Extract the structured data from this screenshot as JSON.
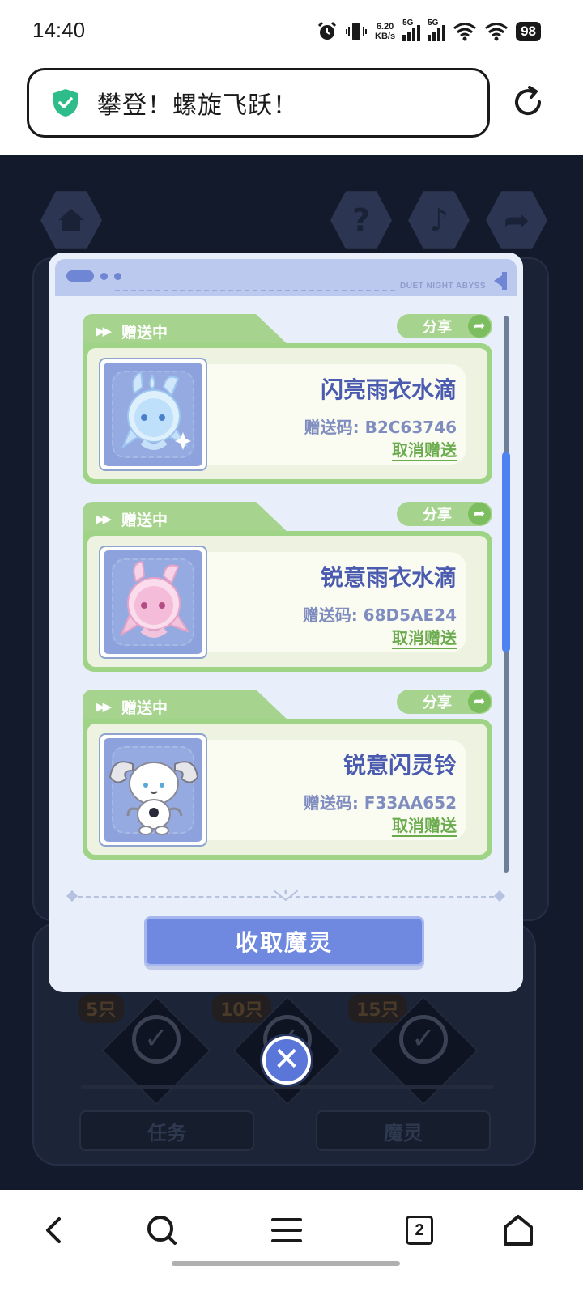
{
  "status_bar": {
    "time": "14:40",
    "net_speed_value": "6.20",
    "net_speed_unit": "KB/s",
    "sim1_label": "5G",
    "sim2_label": "5G",
    "battery": "98",
    "icons": [
      "alarm-icon",
      "vibrate-icon",
      "signal-icon",
      "wifi-icon",
      "battery-icon"
    ]
  },
  "browser": {
    "page_title": "攀登！螺旋飞跃！",
    "secure_icon": "shield-check-icon",
    "reload_icon": "reload-icon"
  },
  "modal": {
    "header_brand": "DUET NIGHT ABYSS",
    "cards": [
      {
        "status": "赠送中",
        "share_label": "分享",
        "name": "闪亮雨衣水滴",
        "code_label": "赠送码:",
        "code": "B2C63746",
        "cancel_label": "取消赠送"
      },
      {
        "status": "赠送中",
        "share_label": "分享",
        "name": "锐意雨衣水滴",
        "code_label": "赠送码:",
        "code": "68D5AE24",
        "cancel_label": "取消赠送"
      },
      {
        "status": "赠送中",
        "share_label": "分享",
        "name": "锐意闪灵铃",
        "code_label": "赠送码:",
        "code": "F33AA652",
        "cancel_label": "取消赠送"
      }
    ],
    "collect_button": "收取魔灵",
    "close_icon": "close-icon"
  },
  "background": {
    "tiers": [
      "5只",
      "10只",
      "15只"
    ],
    "tasks_button": "任务",
    "sprites_button": "魔灵"
  },
  "bottom_nav": {
    "tab_count": "2",
    "icons": [
      "back-icon",
      "search-icon",
      "menu-icon",
      "tabs-icon",
      "home-icon"
    ]
  },
  "colors": {
    "accent_blue": "#6f89e0",
    "card_green": "#a6d48e",
    "item_name": "#4a5bb0"
  }
}
